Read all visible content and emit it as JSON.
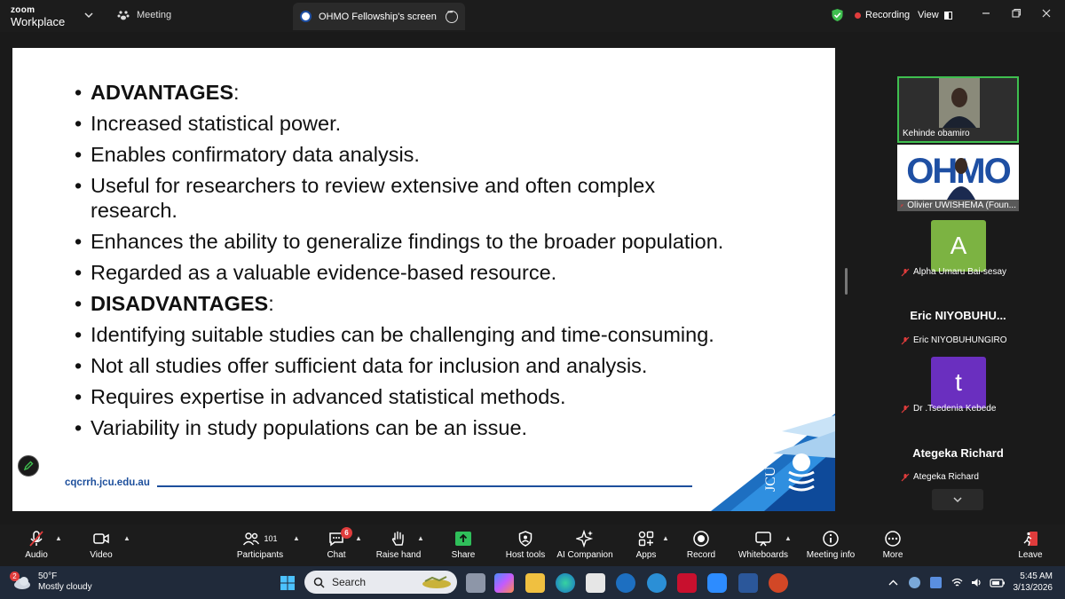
{
  "topbar": {
    "brand_line1": "zoom",
    "brand_line2": "Workplace",
    "meeting_label": "Meeting",
    "screen_tab_label": "OHMO Fellowship's screen",
    "recording_label": "Recording",
    "view_label": "View"
  },
  "slide": {
    "items": [
      {
        "text": "ADVANTAGES",
        "suffix": ":",
        "heading": true
      },
      {
        "text": "Increased statistical power."
      },
      {
        "text": "Enables confirmatory data analysis."
      },
      {
        "text": "Useful for researchers to review extensive and often complex research."
      },
      {
        "text": "Enhances the ability to generalize findings to the broader population."
      },
      {
        "text": "Regarded as a valuable evidence-based resource."
      },
      {
        "text": "DISADVANTAGES",
        "suffix": ":",
        "heading": true
      },
      {
        "text": "Identifying suitable studies can be challenging and time-consuming."
      },
      {
        "text": "Not all studies offer sufficient data for inclusion and analysis."
      },
      {
        "text": "Requires expertise in advanced statistical methods."
      },
      {
        "text": "Variability in study populations can be an issue."
      }
    ],
    "url": "cqcrrh.jcu.edu.au",
    "logo_text": "JCU"
  },
  "participants": {
    "p1": "Kehinde obamiro",
    "p2": "Olivier UWISHEMA (Foun...",
    "p2_logo": "OHMO",
    "p3": "Alpha Umaru Bai-sesay",
    "p3_initial": "A",
    "p4_big": "Eric  NIYOBUHU...",
    "p4": "Eric NIYOBUHUNGIRO",
    "p5": "Dr .Tsedenia Kebede",
    "p5_initial": "t",
    "p6_big": "Ategeka Richard",
    "p6": "Ategeka Richard"
  },
  "toolbar": {
    "audio": "Audio",
    "video": "Video",
    "participants": "Participants",
    "participants_count": "101",
    "chat": "Chat",
    "chat_badge": "6",
    "raise_hand": "Raise hand",
    "share": "Share",
    "host_tools": "Host tools",
    "ai_companion": "AI Companion",
    "apps": "Apps",
    "record": "Record",
    "whiteboards": "Whiteboards",
    "meeting_info": "Meeting info",
    "more": "More",
    "leave": "Leave"
  },
  "taskbar": {
    "weather_badge": "2",
    "temperature": "50°F",
    "condition": "Mostly cloudy",
    "search_placeholder": "Search",
    "time": "5:45 AM",
    "date": "3/13/2026"
  },
  "colors": {
    "accent_green": "#3fbf4f",
    "record_red": "#e03c3c",
    "share_green": "#2fbf5a",
    "jcu_blue": "#1d4f9c",
    "avatar_a": "#7cb342",
    "avatar_t": "#6a2fbf"
  }
}
